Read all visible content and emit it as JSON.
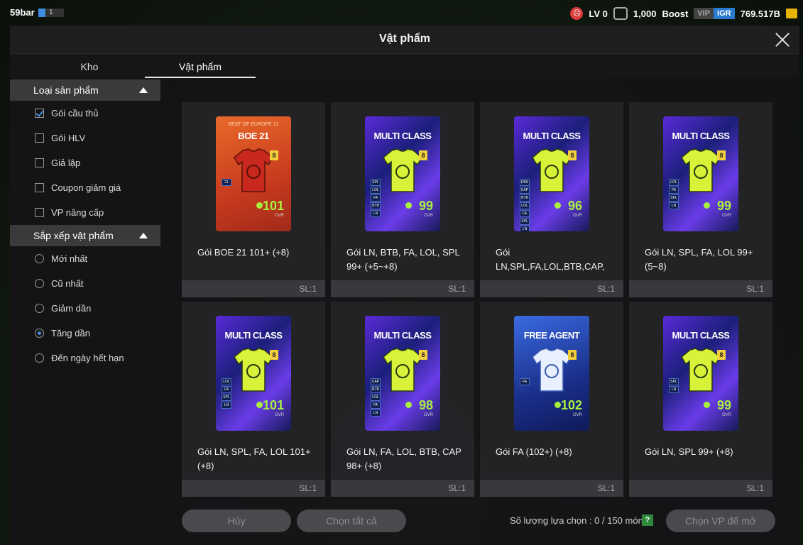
{
  "status": {
    "user_name": "59bar",
    "user_level": "1",
    "lv_text": "LV 0",
    "coins": "1,000",
    "boost_label": "Boost",
    "vip_label": "VIP",
    "igr_label": "IGR",
    "balance": "769.517B"
  },
  "window": {
    "title": "Vật phẩm"
  },
  "tabs": [
    {
      "label": "Kho",
      "active": false
    },
    {
      "label": "Vật phẩm",
      "active": true
    }
  ],
  "sidebar": {
    "product_type": {
      "heading": "Loại sản phẩm",
      "options": [
        {
          "label": "Gói cầu thủ",
          "checked": true
        },
        {
          "label": "Gói HLV",
          "checked": false
        },
        {
          "label": "Giả lập",
          "checked": false
        },
        {
          "label": "Coupon giảm giá",
          "checked": false
        },
        {
          "label": "VP nâng cấp",
          "checked": false
        }
      ]
    },
    "sort": {
      "heading": "Sắp xếp vật phẩm",
      "options": [
        {
          "label": "Mới nhất",
          "selected": false
        },
        {
          "label": "Cũ nhất",
          "selected": false
        },
        {
          "label": "Giảm dần",
          "selected": false
        },
        {
          "label": "Tăng dần",
          "selected": true
        },
        {
          "label": "Đến ngày hết hạn",
          "selected": false
        }
      ]
    }
  },
  "items": [
    {
      "pack": "boe",
      "pack_title": "BOE 21",
      "pack_sub": "BEST OF EUROPE 21",
      "level": "8",
      "ovr": "101",
      "ovr_label": "OVR",
      "tags": [
        "21"
      ],
      "name": "Gói BOE 21 101+ (+8)",
      "qty": "SL:1"
    },
    {
      "pack": "multi",
      "pack_title": "MULTI CLASS",
      "pack_sub": "",
      "level": "8",
      "ovr": "99",
      "ovr_label": "OVR",
      "tags": [
        "SPL",
        "LOL",
        "FA",
        "BTB",
        "LN"
      ],
      "name": "Gói LN, BTB, FA, LOL, SPL 99+ (+5~+8)",
      "qty": "SL:1"
    },
    {
      "pack": "multi",
      "pack_title": "MULTI CLASS",
      "pack_sub": "",
      "level": "8",
      "ovr": "96",
      "ovr_label": "OVR",
      "tags": [
        "EBS",
        "CAP",
        "BTB",
        "LOL",
        "FA",
        "SPL",
        "LN"
      ],
      "name": "Gói LN,SPL,FA,LOL,BTB,CAP,",
      "qty": "SL:1"
    },
    {
      "pack": "multi",
      "pack_title": "MULTI CLASS",
      "pack_sub": "",
      "level": "8",
      "ovr": "99",
      "ovr_label": "OVR",
      "tags": [
        "LOL",
        "FA",
        "SPL",
        "LN"
      ],
      "name": "Gói LN, SPL, FA, LOL 99+ (5~8)",
      "qty": "SL:1"
    },
    {
      "pack": "multi",
      "pack_title": "MULTI CLASS",
      "pack_sub": "",
      "level": "8",
      "ovr": "101",
      "ovr_label": "OVR",
      "tags": [
        "LOL",
        "FA",
        "SPL",
        "LN"
      ],
      "name": "Gói LN, SPL, FA, LOL 101+ (+8)",
      "qty": "SL:1"
    },
    {
      "pack": "multi",
      "pack_title": "MULTI CLASS",
      "pack_sub": "",
      "level": "8",
      "ovr": "98",
      "ovr_label": "OVR",
      "tags": [
        "CAP",
        "BTB",
        "LOL",
        "FA",
        "LN"
      ],
      "name": "Gói LN, FA, LOL, BTB, CAP 98+ (+8)",
      "qty": "SL:1"
    },
    {
      "pack": "fa",
      "pack_title": "FREE AGENT",
      "pack_sub": "",
      "level": "8",
      "ovr": "102",
      "ovr_label": "OVR",
      "tags": [
        "FA"
      ],
      "name": "Gói FA (102+) (+8)",
      "qty": "SL:1"
    },
    {
      "pack": "multi",
      "pack_title": "MULTI CLASS",
      "pack_sub": "",
      "level": "8",
      "ovr": "99",
      "ovr_label": "OVR",
      "tags": [
        "SPL",
        "LN"
      ],
      "name": "Gói LN, SPL 99+ (+8)",
      "qty": "SL:1"
    }
  ],
  "footer": {
    "cancel_label": "Hủy",
    "select_all_label": "Chọn tất cả",
    "count_text": "Số lượng lựa chọn : 0 / 150 món",
    "help_label": "?",
    "open_label": "Chọn VP để mở"
  },
  "colors": {
    "accent_blue": "#4a8ee0",
    "ovr_green": "#a8f040",
    "level_yellow": "#f4cf3c"
  }
}
